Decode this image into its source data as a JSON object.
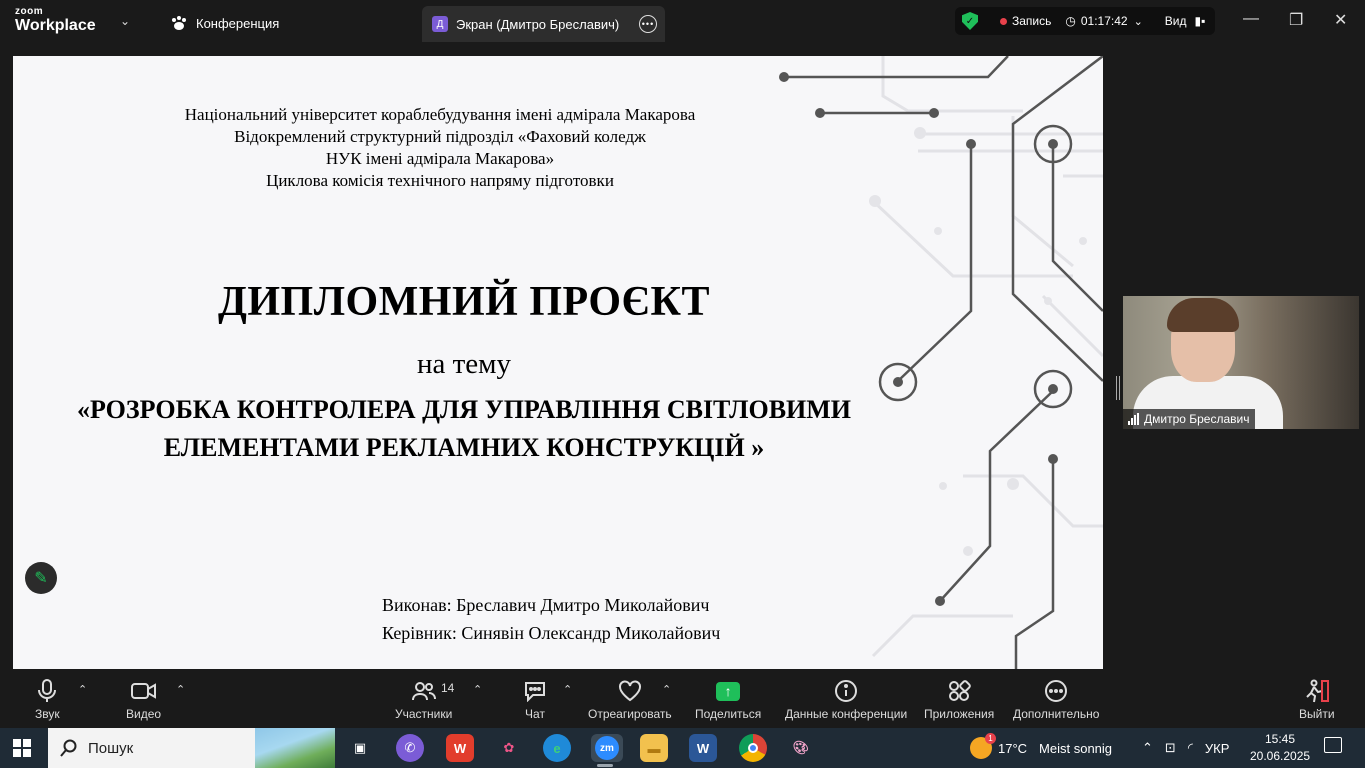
{
  "app": {
    "logo_top": "zoom",
    "logo_bottom": "Workplace",
    "conference_tab": "Конференция",
    "share_tab": "Экран (Дмитро Бреславич)",
    "share_tab_avatar": "Д",
    "recording_label": "Запись",
    "timer": "01:17:42",
    "view_label": "Вид"
  },
  "slide": {
    "header_lines": [
      "Національний університет кораблебудування  імені адмірала Макарова",
      "Відокремлений структурний підрозділ «Фаховий коледж",
      "НУК імені адмірала Макарова»",
      "Циклова комісія  технічного напряму підготовки"
    ],
    "title": "ДИПЛОМНИЙ ПРОЄКТ",
    "theme_label": "на тему",
    "topic_line1": "«РОЗРОБКА КОНТРОЛЕРА ДЛЯ УПРАВЛІННЯ СВІТЛОВИМИ",
    "topic_line2": "ЕЛЕМЕНТАМИ РЕКЛАМНИХ КОНСТРУКЦІЙ »",
    "author": "Виконав: Бреславич Дмитро Миколайович",
    "supervisor": "Керівник: Синявін Олександр Миколайович"
  },
  "participant": {
    "name": "Дмитро Бреславич"
  },
  "toolbar": {
    "audio": "Звук",
    "video": "Видео",
    "participants": "Участники",
    "participants_count": "14",
    "chat": "Чат",
    "react": "Отреагировать",
    "share": "Поделиться",
    "info": "Данные конференции",
    "apps": "Приложения",
    "more": "Дополнительно",
    "leave": "Выйти"
  },
  "taskbar": {
    "search_label": "Пошук",
    "weather_temp": "17°C",
    "weather_text": "Meist sonnig",
    "weather_badge": "1",
    "language": "УКР",
    "time": "15:45",
    "date": "20.06.2025"
  },
  "colors": {
    "accent_green": "#1fbf5a",
    "record_red": "#e8414b",
    "bar_bg": "#1a1a1a",
    "taskbar_bg": "#1f2b36"
  }
}
